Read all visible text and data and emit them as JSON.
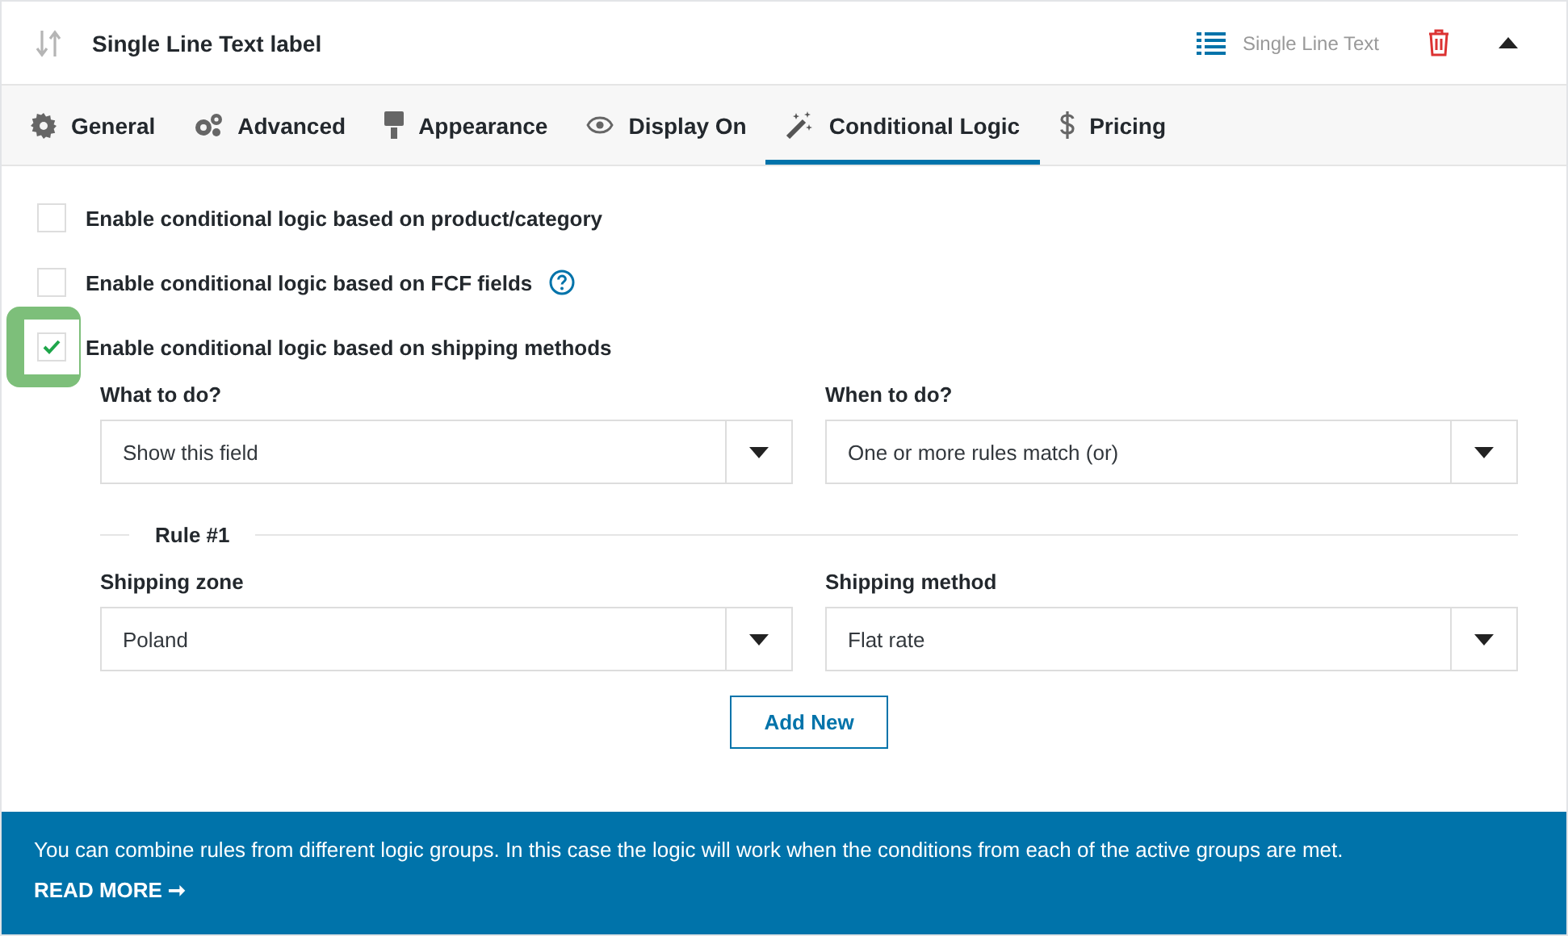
{
  "header": {
    "title": "Single Line Text label",
    "field_type": "Single Line Text"
  },
  "tabs": [
    {
      "label": "General",
      "selected": false
    },
    {
      "label": "Advanced",
      "selected": false
    },
    {
      "label": "Appearance",
      "selected": false
    },
    {
      "label": "Display On",
      "selected": false
    },
    {
      "label": "Conditional Logic",
      "selected": true
    },
    {
      "label": "Pricing",
      "selected": false
    }
  ],
  "options": [
    {
      "label": "Enable conditional logic based on product/category",
      "checked": false,
      "help": false,
      "highlighted": false
    },
    {
      "label": "Enable conditional logic based on FCF fields",
      "checked": false,
      "help": true,
      "highlighted": false
    },
    {
      "label": "Enable conditional logic based on shipping methods",
      "checked": true,
      "help": false,
      "highlighted": true
    }
  ],
  "settings": [
    {
      "label": "What to do?",
      "value": "Show this field"
    },
    {
      "label": "When to do?",
      "value": "One or more rules match (or)"
    }
  ],
  "rule": {
    "title": "Rule #1",
    "fields": [
      {
        "label": "Shipping zone",
        "value": "Poland"
      },
      {
        "label": "Shipping method",
        "value": "Flat rate"
      }
    ]
  },
  "add_button": "Add New",
  "notice": {
    "text": "You can combine rules from different logic groups. In this case the logic will work when the conditions from each of the active groups are met.",
    "link": "READ MORE ➞"
  }
}
